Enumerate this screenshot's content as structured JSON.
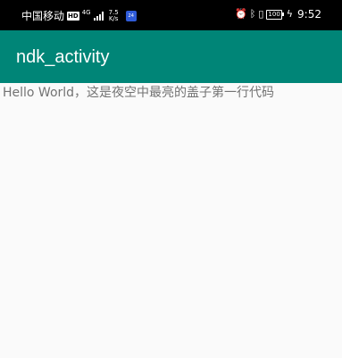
{
  "status_bar": {
    "carrier": "中国移动",
    "hd_badge": "HD",
    "network_type": "4G",
    "speed_value": "7.5",
    "speed_unit": "K/s",
    "notification_badge": "24",
    "battery": "100",
    "time": "9:52",
    "icons": [
      "alarm-icon",
      "bluetooth-icon",
      "vibrate-icon",
      "battery-icon",
      "charging-icon"
    ]
  },
  "app_bar": {
    "title": "ndk_activity",
    "color": "#008577"
  },
  "main": {
    "text": "Hello World，这是夜空中最亮的盖子第一行代码"
  },
  "colors": {
    "status_bar": "#000000",
    "background": "#fafafa",
    "text": "#737373"
  }
}
